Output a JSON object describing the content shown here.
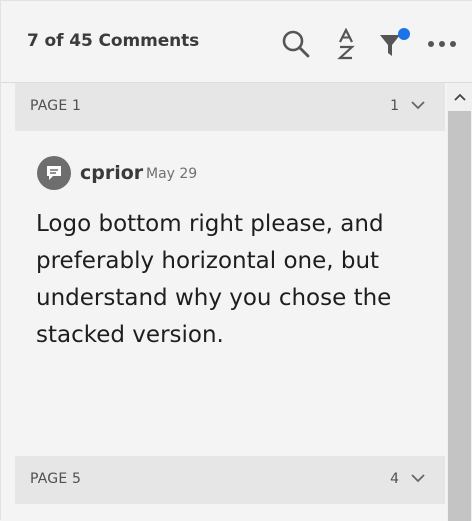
{
  "header": {
    "title": "7 of 45 Comments",
    "icons": [
      "search-icon",
      "sort-az-icon",
      "filter-icon",
      "more-icon"
    ],
    "filter_badge_color": "#1a73e8"
  },
  "groups": [
    {
      "label": "PAGE 1",
      "count": "1",
      "comments": [
        {
          "author": "cprior",
          "date": "May 29",
          "text": "Logo bottom right please, and preferably horizontal one, but understand why you chose the stacked version."
        }
      ]
    },
    {
      "label": "PAGE 5",
      "count": "4"
    }
  ],
  "colors": {
    "background": "#f4f4f4",
    "group_header": "#e6e6e6",
    "scroll_thumb": "#c4c4c4",
    "avatar": "#6e6e6e"
  }
}
